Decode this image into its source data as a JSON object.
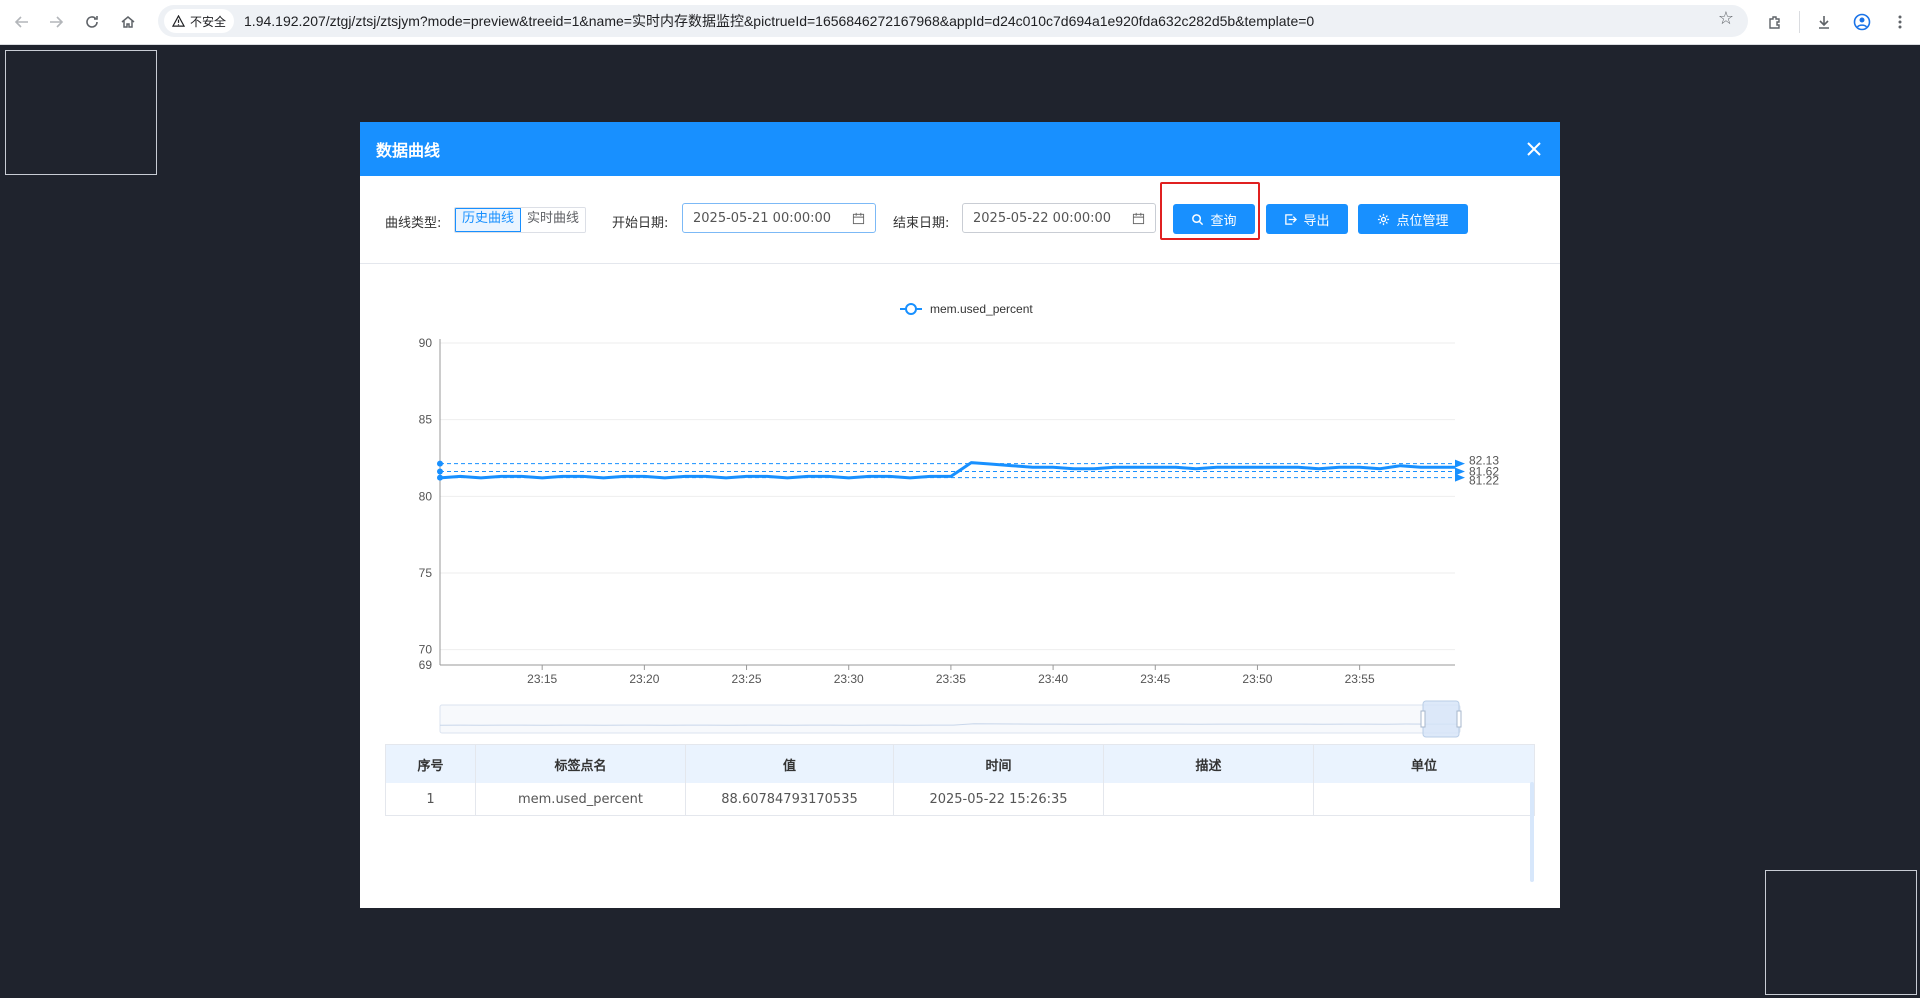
{
  "browser": {
    "security_label": "不安全",
    "url": "1.94.192.207/ztgj/ztsj/ztsjym?mode=preview&treeid=1&name=实时内存数据监控&pictrueId=1656846272167968&appId=d24c010c7d694a1e920fda632c282d5b&template=0"
  },
  "dialog": {
    "title": "数据曲线",
    "curve_type_label": "曲线类型:",
    "curve_type_options": [
      "历史曲线",
      "实时曲线"
    ],
    "curve_type_selected": "历史曲线",
    "start_label": "开始日期:",
    "start_value": "2025-05-21 00:00:00",
    "end_label": "结束日期:",
    "end_value": "2025-05-22 00:00:00",
    "query_button": "查询",
    "export_button": "导出",
    "points_button": "点位管理"
  },
  "chart_data": {
    "type": "line",
    "legend": [
      "mem.used_percent"
    ],
    "legend_position": "top-center",
    "series": [
      {
        "name": "mem.used_percent",
        "x": [
          "23:10",
          "23:11",
          "23:12",
          "23:13",
          "23:14",
          "23:15",
          "23:16",
          "23:17",
          "23:18",
          "23:19",
          "23:20",
          "23:21",
          "23:22",
          "23:23",
          "23:24",
          "23:25",
          "23:26",
          "23:27",
          "23:28",
          "23:29",
          "23:30",
          "23:31",
          "23:32",
          "23:33",
          "23:34",
          "23:35",
          "23:36",
          "23:37",
          "23:38",
          "23:39",
          "23:40",
          "23:41",
          "23:42",
          "23:43",
          "23:44",
          "23:45",
          "23:46",
          "23:47",
          "23:48",
          "23:49",
          "23:50",
          "23:51",
          "23:52",
          "23:53",
          "23:54",
          "23:55",
          "23:56",
          "23:57",
          "23:58",
          "23:59",
          "23:59:40"
        ],
        "values": [
          81.2,
          81.3,
          81.2,
          81.3,
          81.3,
          81.2,
          81.3,
          81.3,
          81.2,
          81.3,
          81.3,
          81.2,
          81.3,
          81.3,
          81.2,
          81.3,
          81.3,
          81.2,
          81.3,
          81.3,
          81.2,
          81.3,
          81.3,
          81.2,
          81.3,
          81.3,
          82.2,
          82.1,
          82.0,
          81.9,
          81.9,
          81.8,
          81.8,
          81.9,
          81.9,
          81.9,
          81.9,
          81.8,
          81.9,
          81.9,
          81.9,
          81.9,
          81.9,
          81.8,
          81.9,
          81.9,
          81.8,
          82.0,
          81.9,
          81.9,
          81.9
        ]
      }
    ],
    "markline_labels": [
      "82.13",
      "81.62",
      "81.22"
    ],
    "markline_values": [
      82.13,
      81.62,
      81.22
    ],
    "x_ticks": [
      "23:15",
      "23:20",
      "23:25",
      "23:30",
      "23:35",
      "23:40",
      "23:45",
      "23:50",
      "23:55"
    ],
    "y_ticks": [
      70,
      75,
      80,
      85,
      90
    ],
    "y_min_label": 69,
    "ylim": [
      69,
      90
    ],
    "xlim": [
      "23:10",
      "23:59:40"
    ],
    "grid": true,
    "colors": {
      "line": "#1890ff"
    },
    "data_zoom": true
  },
  "table": {
    "headers": [
      "序号",
      "标签点名",
      "值",
      "时间",
      "描述",
      "单位"
    ],
    "rows": [
      [
        "1",
        "mem.used_percent",
        "88.60784793170535",
        "2025-05-22 15:26:35",
        "",
        ""
      ]
    ]
  },
  "colors": {
    "page_bg": "#1f232d",
    "primary": "#1890ff",
    "highlight": "#e02020",
    "table_header": "#eaf3fe"
  }
}
